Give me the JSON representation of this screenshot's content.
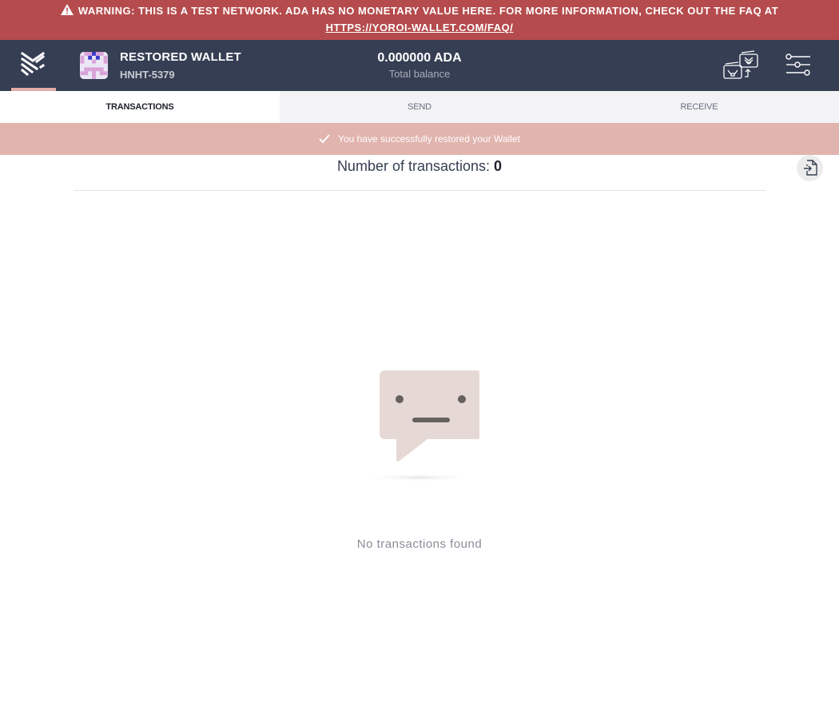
{
  "banner": {
    "warning_text": "WARNING: THIS IS A TEST NETWORK. ADA HAS NO MONETARY VALUE HERE. FOR MORE INFORMATION, CHECK OUT THE FAQ AT",
    "faq_link": "HTTPS://YOROI-WALLET.COM/FAQ/",
    "icon": "warning-triangle-icon"
  },
  "topbar": {
    "logo_icon": "yoroi-logo-icon",
    "wallet_name": "RESTORED WALLET",
    "wallet_plate": "HNHT-5379",
    "balance_amount": "0.000000 ADA",
    "balance_label": "Total balance",
    "wallet_switch_icon": "switch-wallet-icon",
    "settings_icon": "settings-sliders-icon"
  },
  "tabs": [
    {
      "label": "TRANSACTIONS",
      "active": true
    },
    {
      "label": "SEND",
      "active": false
    },
    {
      "label": "RECEIVE",
      "active": false
    }
  ],
  "notification": {
    "text": "You have successfully restored your Wallet",
    "icon": "check-icon"
  },
  "summary": {
    "label": "Number of transactions: ",
    "count": "0",
    "export_icon": "export-file-icon"
  },
  "empty_state": {
    "icon": "empty-chat-face-icon",
    "text": "No transactions found"
  },
  "colors": {
    "banner": "#b54b4d",
    "topbar": "#353e53",
    "accent": "#e2ada6",
    "notification": "#e1b4ae"
  }
}
